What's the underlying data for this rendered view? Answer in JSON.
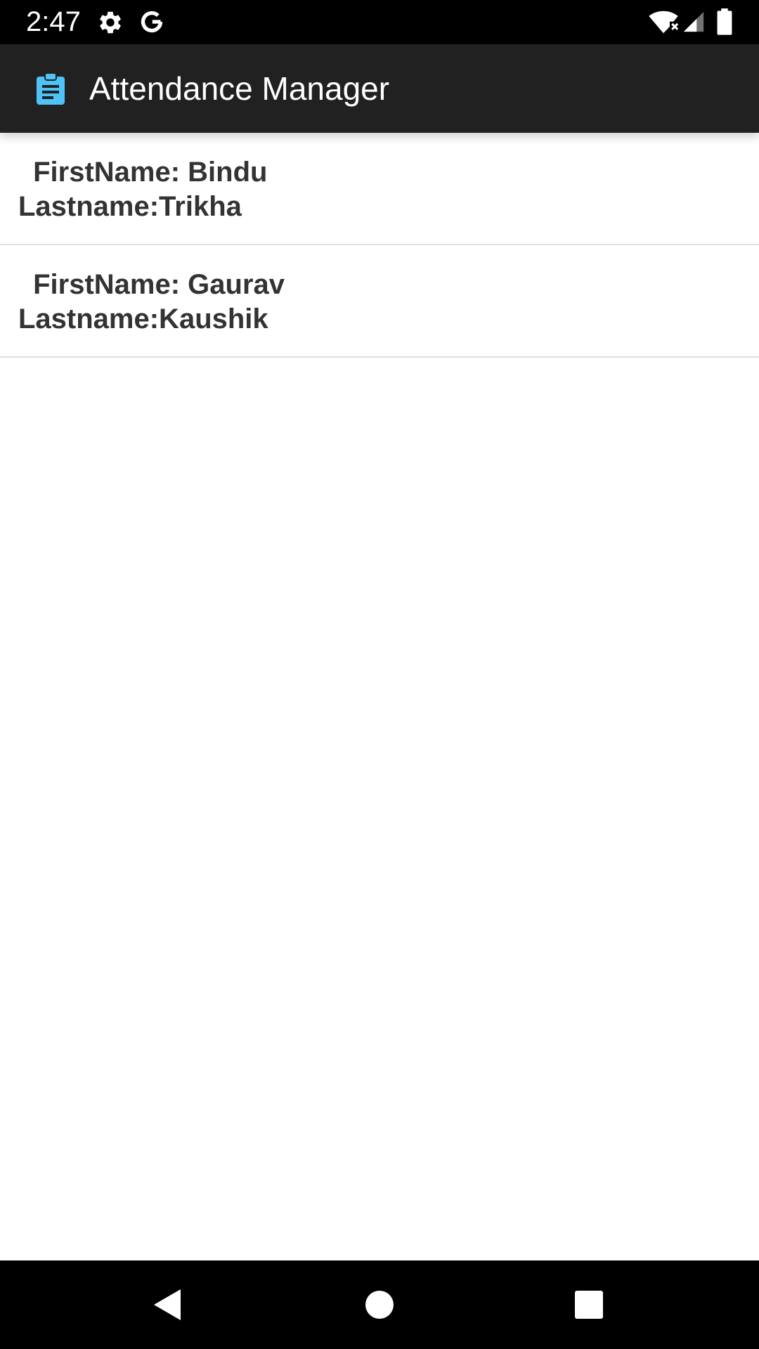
{
  "status_bar": {
    "time": "2:47",
    "icons": [
      "settings-icon",
      "google-icon",
      "wifi-icon",
      "signal-icon",
      "battery-icon"
    ]
  },
  "app_bar": {
    "title": "Attendance Manager",
    "icon": "clipboard-icon",
    "icon_color": "#4fc3f7",
    "background": "#212121"
  },
  "students": [
    {
      "first_line": " FirstName: Bindu",
      "last_line": "Lastname:Trikha"
    },
    {
      "first_line": " FirstName: Gaurav",
      "last_line": "Lastname:Kaushik"
    }
  ],
  "nav_bar": {
    "buttons": [
      "back-icon",
      "home-icon",
      "recents-icon"
    ]
  }
}
